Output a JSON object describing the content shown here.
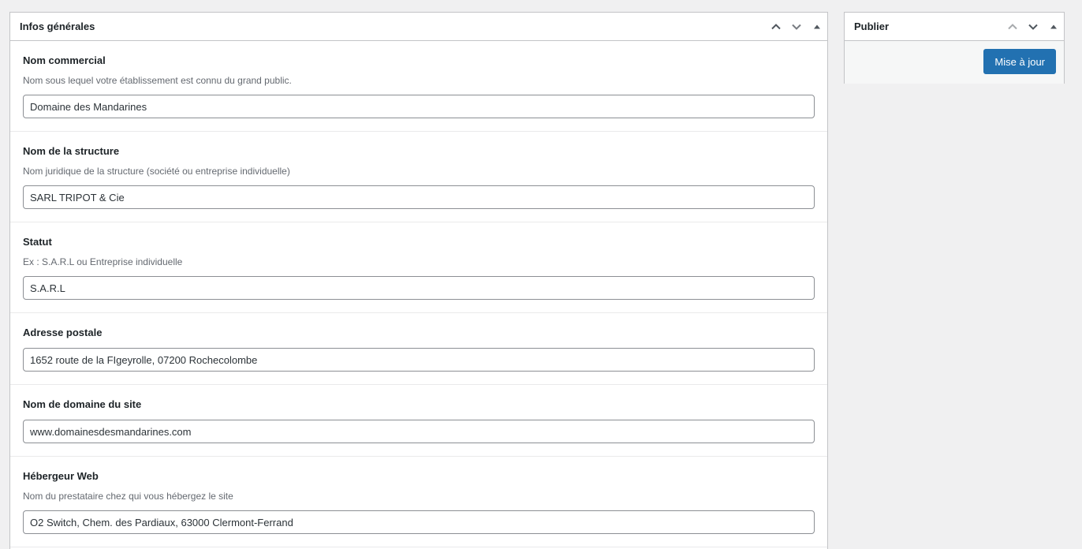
{
  "main_box": {
    "title": "Infos générales",
    "fields": [
      {
        "label": "Nom commercial",
        "description": "Nom sous lequel votre établissement est connu du grand public.",
        "value": "Domaine des Mandarines"
      },
      {
        "label": "Nom de la structure",
        "description": "Nom juridique de la structure (société ou entreprise individuelle)",
        "value": "SARL TRIPOT & Cie"
      },
      {
        "label": "Statut",
        "description": "Ex : S.A.R.L ou Entreprise individuelle",
        "value": "S.A.R.L"
      },
      {
        "label": "Adresse postale",
        "value": "1652 route de la FIgeyrolle, 07200 Rochecolombe"
      },
      {
        "label": "Nom de domaine du site",
        "value": "www.domainesdesmandarines.com"
      },
      {
        "label": "Hébergeur Web",
        "description": "Nom du prestataire chez qui vous hébergez le site",
        "value": "O2 Switch, Chem. des Pardiaux, 63000 Clermont-Ferrand"
      }
    ]
  },
  "publish_box": {
    "title": "Publier",
    "update_button": "Mise à jour"
  },
  "icons": {
    "move_up": "chevron-up-icon",
    "move_down": "chevron-down-icon",
    "toggle": "triangle-up-icon"
  },
  "colors": {
    "background": "#f0f0f1",
    "border": "#c3c4c7",
    "primary_button": "#2271b1",
    "description_text": "#646970"
  }
}
